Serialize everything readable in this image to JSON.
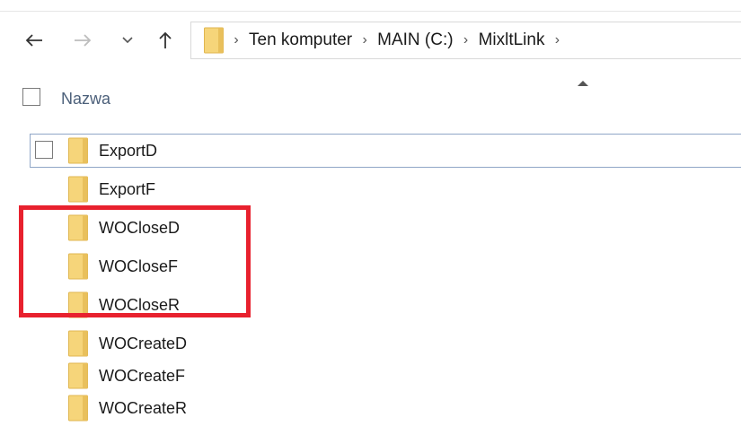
{
  "nav": {
    "back_icon": "arrow-left-icon",
    "forward_icon": "arrow-right-icon",
    "recent_icon": "chevron-down-icon",
    "up_icon": "arrow-up-icon"
  },
  "address": {
    "folder_icon": "folder-icon",
    "separator": "›",
    "crumbs": [
      "Ten komputer",
      "MAIN (C:)",
      "MixltLink"
    ]
  },
  "header": {
    "name_column": "Nazwa"
  },
  "files": [
    {
      "name": "ExportD"
    },
    {
      "name": "ExportF"
    },
    {
      "name": "WOCloseD"
    },
    {
      "name": "WOCloseF"
    },
    {
      "name": "WOCloseR"
    },
    {
      "name": "WOCreateD"
    },
    {
      "name": "WOCreateF"
    },
    {
      "name": "WOCreateR"
    }
  ],
  "colors": {
    "folder": "#f6d57a",
    "highlight": "#e8212e",
    "header_text": "#4c607a",
    "selection_border": "#8fa6c7"
  }
}
